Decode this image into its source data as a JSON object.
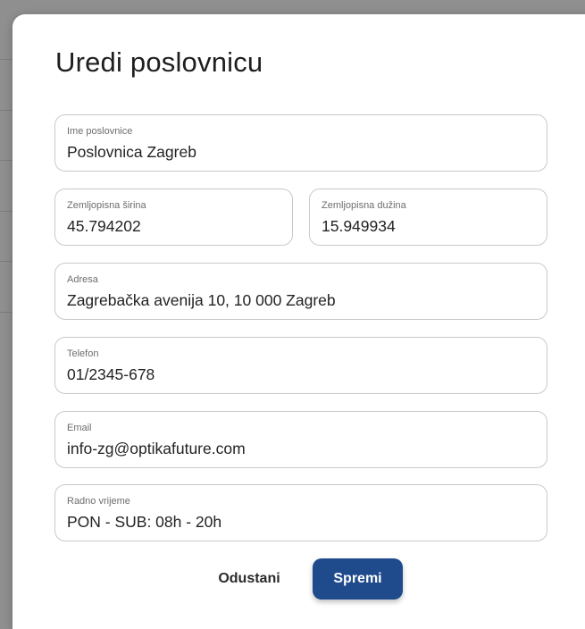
{
  "dialog": {
    "title": "Uredi poslovnicu"
  },
  "form": {
    "name": {
      "label": "Ime poslovnice",
      "value": "Poslovnica Zagreb"
    },
    "latitude": {
      "label": "Zemljopisna širina",
      "value": "45.794202"
    },
    "longitude": {
      "label": "Zemljopisna dužina",
      "value": "15.949934"
    },
    "address": {
      "label": "Adresa",
      "value": "Zagrebačka avenija 10, 10 000 Zagreb"
    },
    "phone": {
      "label": "Telefon",
      "value": "01/2345-678"
    },
    "email": {
      "label": "Email",
      "value": "info-zg@optikafuture.com"
    },
    "working_hours": {
      "label": "Radno vrijeme",
      "value": "PON - SUB: 08h - 20h"
    }
  },
  "actions": {
    "cancel_label": "Odustani",
    "save_label": "Spremi"
  },
  "colors": {
    "primary": "#1f4a8c",
    "backdrop": "#8f8f8f",
    "field_border": "#c9c9c9"
  }
}
